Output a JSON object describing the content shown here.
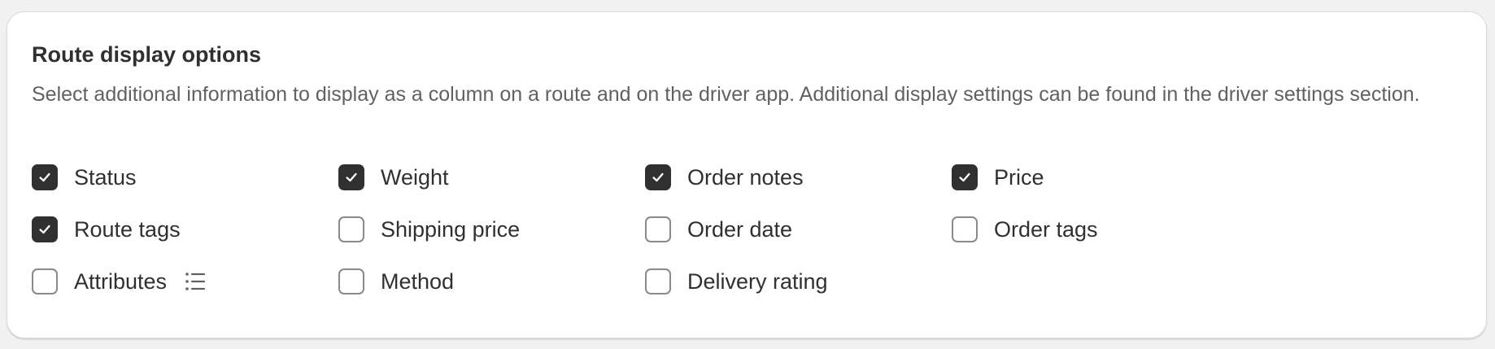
{
  "section": {
    "title": "Route display options",
    "description": "Select additional information to display as a column on a route and on the driver app. Additional display settings can be found in the driver settings section."
  },
  "options": [
    {
      "label": "Status",
      "checked": true
    },
    {
      "label": "Weight",
      "checked": true
    },
    {
      "label": "Order notes",
      "checked": true
    },
    {
      "label": "Price",
      "checked": true
    },
    {
      "label": "Route tags",
      "checked": true
    },
    {
      "label": "Shipping price",
      "checked": false
    },
    {
      "label": "Order date",
      "checked": false
    },
    {
      "label": "Order tags",
      "checked": false
    },
    {
      "label": "Attributes",
      "checked": false,
      "icon": "list-icon"
    },
    {
      "label": "Method",
      "checked": false
    },
    {
      "label": "Delivery rating",
      "checked": false
    }
  ],
  "colors": {
    "checkbox_checked": "#303030",
    "checkbox_border": "#8a8a8a",
    "text_primary": "#303030",
    "text_secondary": "#616161",
    "page_background": "#f1f1f1",
    "card_background": "#ffffff"
  }
}
